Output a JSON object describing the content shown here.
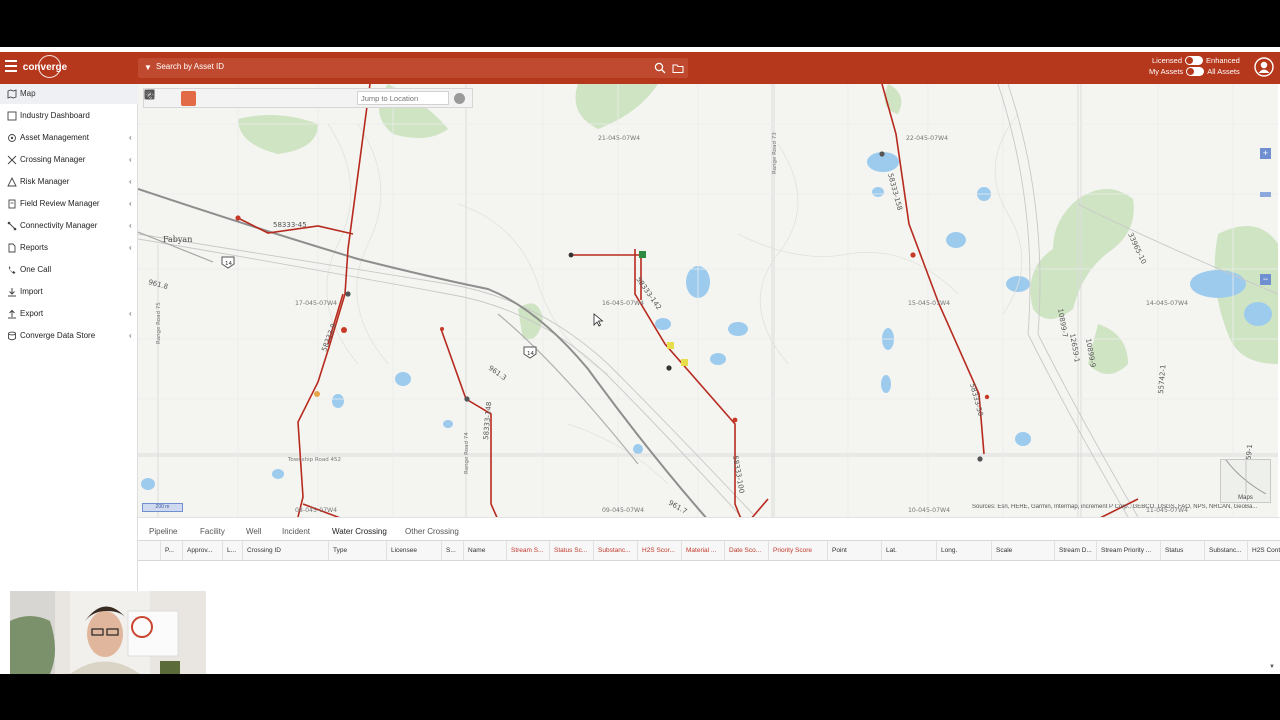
{
  "app": {
    "logo_text": "converge",
    "search_label": "Search by Asset ID",
    "toggles": [
      {
        "left": "Licensed",
        "right": "Enhanced"
      },
      {
        "left": "My Assets",
        "right": "All Assets"
      }
    ]
  },
  "sidebar": {
    "items": [
      {
        "label": "Map",
        "chevron": ""
      },
      {
        "label": "Industry Dashboard",
        "chevron": ""
      },
      {
        "label": "Asset Management",
        "chevron": "‹"
      },
      {
        "label": "Crossing Manager",
        "chevron": "‹"
      },
      {
        "label": "Risk Manager",
        "chevron": "‹"
      },
      {
        "label": "Field Review Manager",
        "chevron": "‹"
      },
      {
        "label": "Connectivity Manager",
        "chevron": "‹"
      },
      {
        "label": "Reports",
        "chevron": "‹"
      },
      {
        "label": "One Call",
        "chevron": ""
      },
      {
        "label": "Import",
        "chevron": ""
      },
      {
        "label": "Export",
        "chevron": "‹"
      },
      {
        "label": "Converge Data Store",
        "chevron": "‹"
      }
    ]
  },
  "map": {
    "jump_placeholder": "Jump to Location",
    "scale_text": "200 m",
    "attribution": "Sources: Esri, HERE, Garmin, Intermap, increment P Corp., GEBCO, USGS, FAO, NPS, NRCAN, GeoBa...",
    "basemap_label": "Maps",
    "place_labels": [
      "Fabyan"
    ],
    "section_labels": [
      "21-045-07W4",
      "22-045-07W4",
      "17-045-07W4",
      "16-045-07W4",
      "15-045-07W4",
      "14-045-07W4",
      "08-045-07W4",
      "09-045-07W4",
      "10-045-07W4",
      "11-045-07W4"
    ],
    "line_labels": [
      "58333-45",
      "58333-9",
      "58333-142",
      "58333-158",
      "58333-50",
      "58333-100",
      "58333-148",
      "58333-16",
      "58333-12",
      "961.8",
      "961.3",
      "961.7",
      "10899-7",
      "12659-1",
      "10899-9",
      "33965-10",
      "55742-1",
      "5959-1"
    ],
    "road_labels": [
      "Township Road 452",
      "Range Road 75",
      "Range Road 74",
      "Range Road 73"
    ],
    "highway_labels": [
      "14",
      "14"
    ]
  },
  "tabs": [
    "Pipeline",
    "Facility",
    "Well",
    "Incident",
    "Water Crossing",
    "Other Crossing"
  ],
  "active_tab": "Water Crossing",
  "columns": [
    {
      "label": "P...",
      "red": false
    },
    {
      "label": "Approv...",
      "red": false
    },
    {
      "label": "L...",
      "red": false
    },
    {
      "label": "Crossing ID",
      "red": false
    },
    {
      "label": "Type",
      "red": false
    },
    {
      "label": "Licensee",
      "red": false
    },
    {
      "label": "S...",
      "red": false
    },
    {
      "label": "Name",
      "red": false
    },
    {
      "label": "Stream S...",
      "red": true
    },
    {
      "label": "Status Sc...",
      "red": true
    },
    {
      "label": "Substanc...",
      "red": true
    },
    {
      "label": "H2S Scor...",
      "red": true
    },
    {
      "label": "Material ...",
      "red": true
    },
    {
      "label": "Date Sco...",
      "red": true
    },
    {
      "label": "Priority Score",
      "red": true
    },
    {
      "label": "Point",
      "red": false
    },
    {
      "label": "Lat.",
      "red": false
    },
    {
      "label": "Long.",
      "red": false
    },
    {
      "label": "Scale",
      "red": false
    },
    {
      "label": "Stream D...",
      "red": false
    },
    {
      "label": "Stream Priority ...",
      "red": false
    },
    {
      "label": "Status",
      "red": false
    },
    {
      "label": "Substanc...",
      "red": false
    },
    {
      "label": "H2S Cont...",
      "red": false
    }
  ],
  "colors": {
    "brand": "#b5371c",
    "pipeline": "#b72a1e",
    "highway": "#8e8e8e",
    "water": "#8fc4ea",
    "vegetation": "#cfe4c3"
  }
}
